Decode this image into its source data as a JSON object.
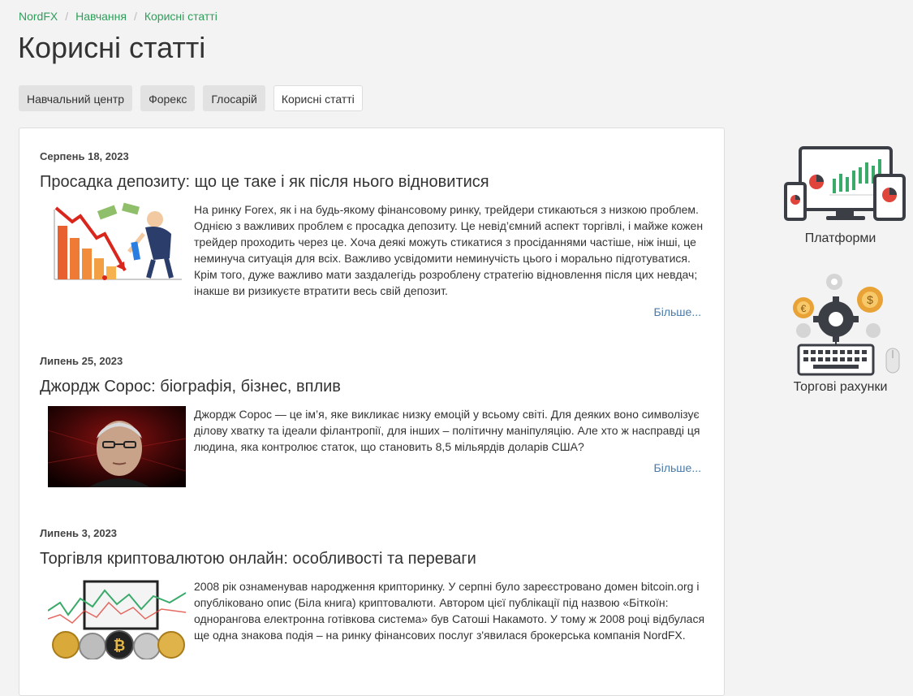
{
  "breadcrumb": {
    "items": [
      "NordFX",
      "Навчання",
      "Корисні статті"
    ]
  },
  "page_title": "Корисні статті",
  "tabs": [
    {
      "label": "Навчальний центр"
    },
    {
      "label": "Форекс"
    },
    {
      "label": "Глосарій"
    },
    {
      "label": "Корисні статті",
      "active": true
    }
  ],
  "articles": [
    {
      "date": "Серпень 18, 2023",
      "title": "Просадка депозиту: що це таке і як після нього відновитися",
      "text": "На ринку Forex, як і на будь-якому фінансовому ринку, трейдери стикаються з низкою проблем. Однією з важливих проблем є просадка депозиту. Це невід’ємний аспект торгівлі, і майже кожен трейдер проходить через це. Хоча деякі можуть стикатися з просіданнями частіше, ніж інші, це неминуча ситуація для всіх. Важливо усвідомити неминучість цього і морально підготуватися. Крім того, дуже важливо мати заздалегідь розроблену стратегію відновлення після цих невдач; інакше ви ризикуєте втратити весь свій депозит.",
      "more": "Більше...",
      "thumb_icon": "falling-chart-trader-illustration"
    },
    {
      "date": "Липень 25, 2023",
      "title": "Джордж Сорос: біографія, бізнес, вплив",
      "text": "Джордж Сорос — це ім’я, яке викликає низку емоцій у всьому світі. Для деяких воно символізує ділову хватку та ідеали філантропії, для інших – політичну маніпуляцію. Але хто ж насправді ця людина, яка контролює статок, що становить 8,5 мільярдів доларів США?",
      "more": "Більше...",
      "thumb_icon": "portrait-photo"
    },
    {
      "date": "Липень 3, 2023",
      "title": "Торгівля криптовалютою онлайн: особливості та переваги",
      "text": "2008 рік ознаменував народження крипторинку. У серпні було зареєстровано домен bitcoin.org і опубліковано опис (Біла книга) криптовалюти. Автором цієї публікації під назвою «Біткоїн: однорангова електронна готівкова система» був Сатоші Накамото. У тому ж 2008 році відбулася ще одна знакова подія – на ринку фінансових послуг з'явилася брокерська компанія NordFX.",
      "more": "",
      "thumb_icon": "crypto-coins-chart-illustration"
    }
  ],
  "sidebar": {
    "items": [
      {
        "label": "Платформи",
        "icon": "devices-chart-icon"
      },
      {
        "label": "Торгові рахунки",
        "icon": "gears-keyboard-icon"
      }
    ]
  },
  "colors": {
    "link_green": "#2e9e5b",
    "link_blue": "#4a7aa8",
    "chart_green": "#3aaa6a",
    "accent_red": "#e0443a"
  }
}
